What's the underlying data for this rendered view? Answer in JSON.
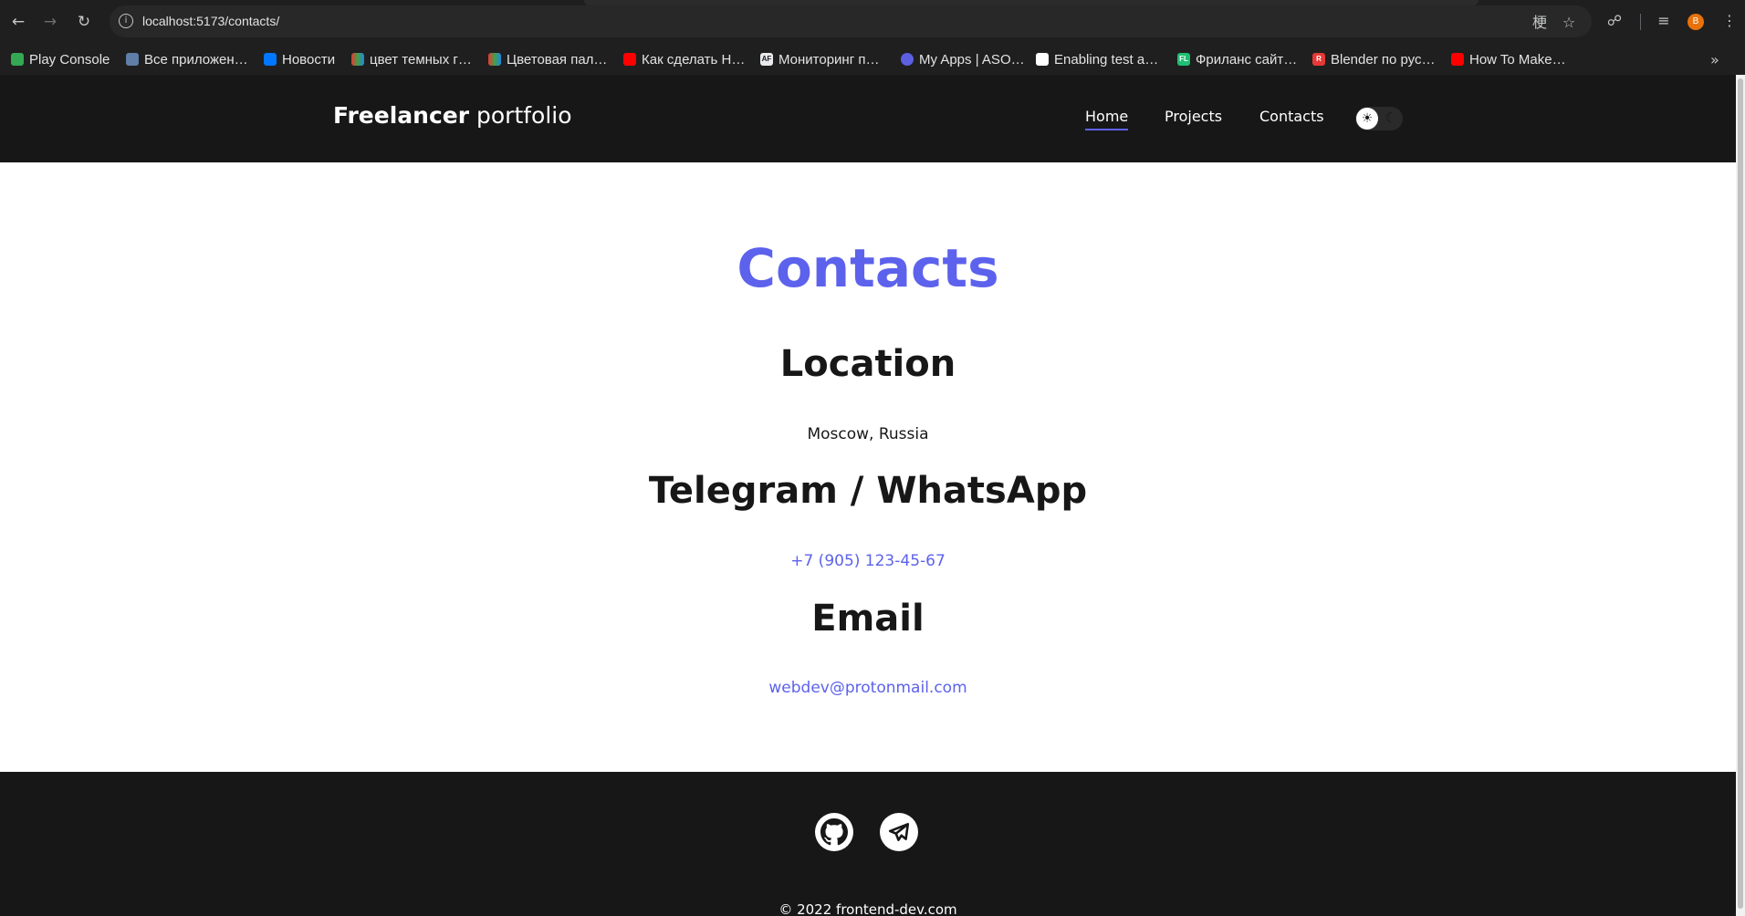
{
  "browser": {
    "url": "localhost:5173/contacts/",
    "bookmarks": [
      {
        "label": "Play Console",
        "color": "#34a853"
      },
      {
        "label": "Все приложен…",
        "color": "#5f7ea8"
      },
      {
        "label": "Новости",
        "color": "#0077ff"
      },
      {
        "label": "цвет темных г…",
        "color": "#333333"
      },
      {
        "label": "Цветовая пал…",
        "color": "#333333"
      },
      {
        "label": "Как сделать Н…",
        "color": "#ff0000"
      },
      {
        "label": "Мониторинг п…",
        "color": "#e8eaed"
      },
      {
        "label": "My Apps | ASO…",
        "color": "#5b5fe0"
      },
      {
        "label": "Enabling test a…",
        "color": "#ffffff"
      },
      {
        "label": "Фриланс сайт…",
        "color": "#1dbf73"
      },
      {
        "label": "Blender по рус…",
        "color": "#e53935"
      },
      {
        "label": "How To Make…",
        "color": "#ff0000"
      }
    ],
    "profile_initial": "B"
  },
  "site": {
    "logo_bold": "Freelancer",
    "logo_rest": "portfolio",
    "nav": {
      "home": "Home",
      "projects": "Projects",
      "contacts": "Contacts"
    },
    "accent_color": "#5c62ec"
  },
  "main": {
    "title": "Contacts",
    "location": {
      "heading": "Location",
      "value": "Moscow, Russia"
    },
    "phone": {
      "heading": "Telegram / WhatsApp",
      "value": "+7 (905) 123-45-67"
    },
    "email": {
      "heading": "Email",
      "value": "webdev@protonmail.com"
    }
  },
  "footer": {
    "copyright": "© 2022 frontend-dev.com",
    "social": [
      "github-icon",
      "telegram-icon"
    ]
  }
}
